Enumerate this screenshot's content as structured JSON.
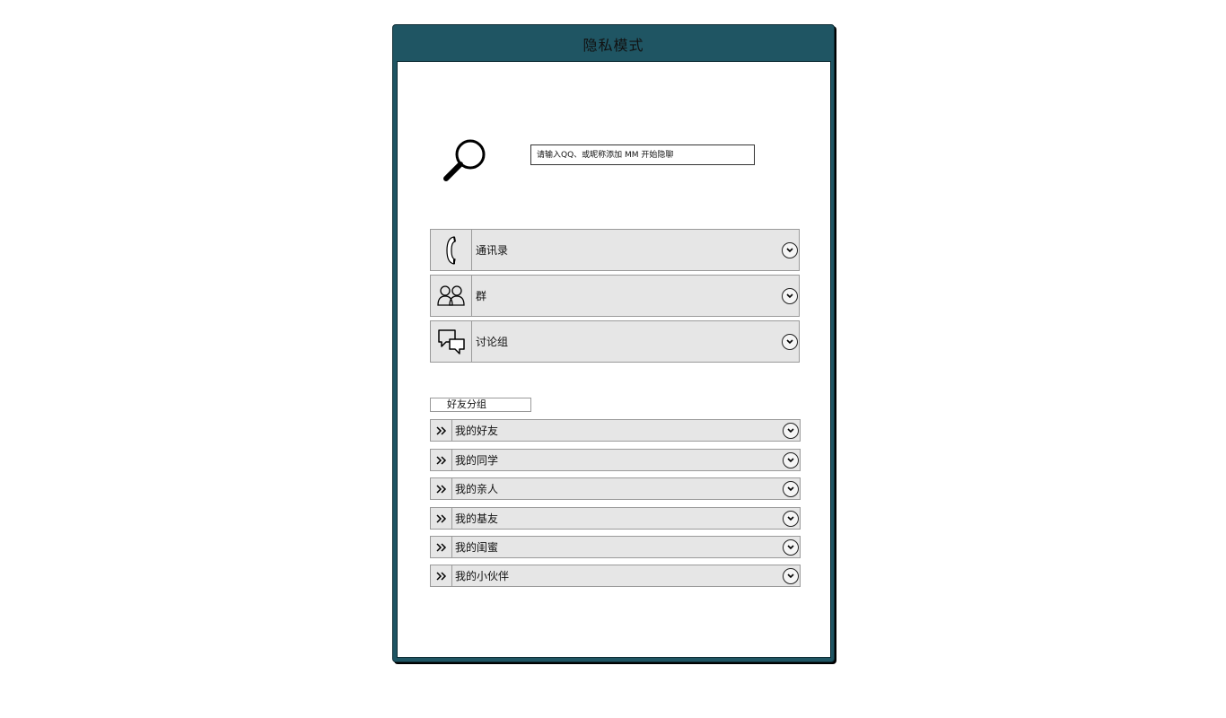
{
  "window": {
    "title": "隐私模式"
  },
  "search": {
    "placeholder": "请输入QQ、或昵称添加 MM 开始隐聊"
  },
  "categories": [
    {
      "label": "通讯录",
      "icon": "phone-icon"
    },
    {
      "label": "群",
      "icon": "group-icon"
    },
    {
      "label": "讨论组",
      "icon": "chat-bubbles-icon"
    }
  ],
  "friend_groups": {
    "header": "好友分组",
    "items": [
      {
        "label": "我的好友"
      },
      {
        "label": "我的同学"
      },
      {
        "label": "我的亲人"
      },
      {
        "label": "我的基友"
      },
      {
        "label": "我的闺蜜"
      },
      {
        "label": "我的小伙伴"
      }
    ]
  },
  "colors": {
    "frame": "#1f5563",
    "row_bg": "#e6e6e6"
  }
}
